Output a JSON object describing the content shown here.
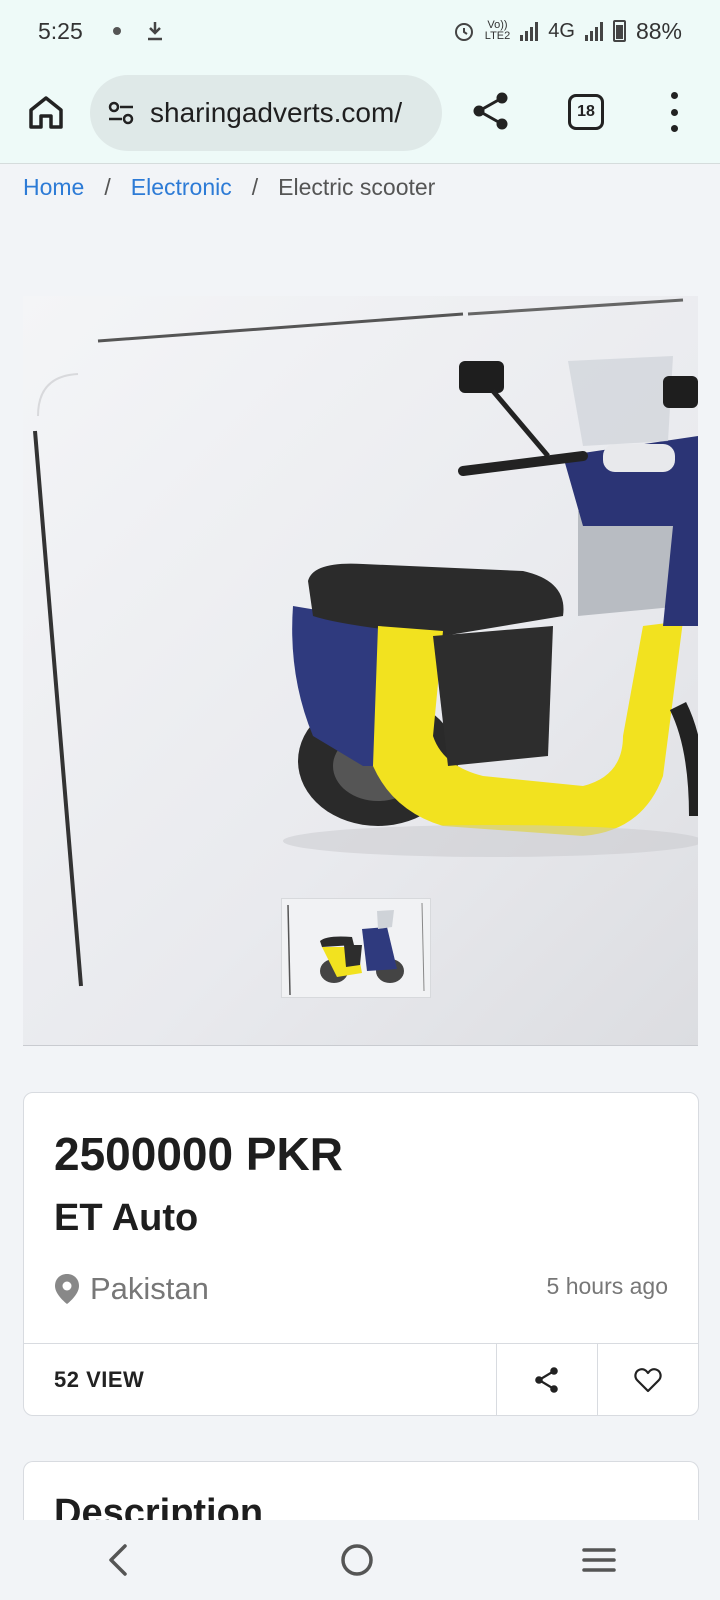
{
  "status_bar": {
    "time": "5:25",
    "network_top": "Vo))",
    "network_bottom": "LTE2",
    "network_type": "4G",
    "battery": "88%"
  },
  "browser": {
    "url": "sharingadverts.com/",
    "tab_count": "18"
  },
  "breadcrumb": {
    "home": "Home",
    "category": "Electronic",
    "current": "Electric scooter",
    "separator": "/"
  },
  "listing": {
    "price": "2500000 PKR",
    "title": "ET Auto",
    "location": "Pakistan",
    "posted": "5 hours ago",
    "views": "52 VIEW"
  },
  "description": {
    "heading": "Description"
  },
  "icons": {
    "home": "home-icon",
    "tune": "site-settings-icon",
    "share": "share-icon",
    "menu": "more-vert-icon",
    "location": "location-pin-icon",
    "favorite": "heart-icon",
    "back": "back-icon",
    "nav_home": "circle-home-icon",
    "recents": "recents-icon"
  },
  "colors": {
    "link": "#2d7bd6",
    "browser_bg": "#eefaf8",
    "page_bg": "#f2f4f7"
  }
}
